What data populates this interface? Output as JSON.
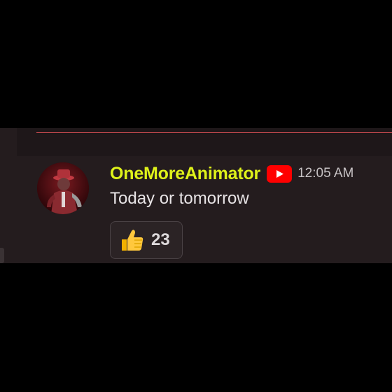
{
  "message": {
    "author": "OneMoreAnimator",
    "badge_icon": "youtube-icon",
    "timestamp": "12:05 AM",
    "text": "Today or tomorrow"
  },
  "reaction": {
    "emoji_icon": "thumbs-up-icon",
    "count": "23"
  },
  "colors": {
    "background": "#000000",
    "panel": "#241c1e",
    "username": "#dff21a",
    "divider": "#c94a4f",
    "youtube_red": "#ff0000"
  }
}
